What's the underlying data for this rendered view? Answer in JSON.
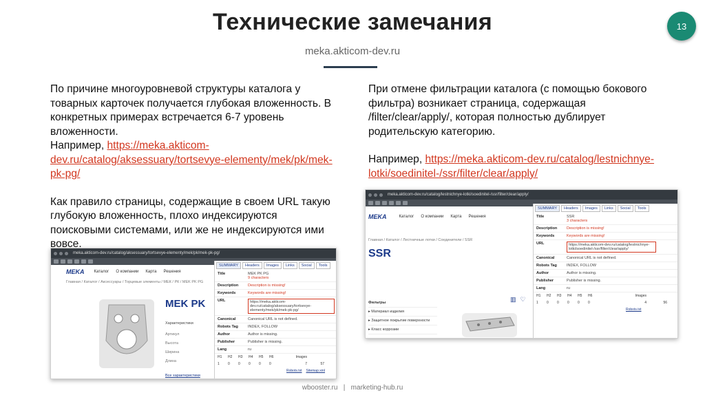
{
  "slide": {
    "title": "Технические замечания",
    "page_number": "13",
    "subtitle": "meka.akticom-dev.ru",
    "footer": "wbooster.ru   |   marketing-hub.ru"
  },
  "left": {
    "para1": "По причине многоуровневой структуры каталога у товарных карточек получается глубокая вложенность. В конкретных примерах встречается 6-7 уровень вложенности.",
    "example_prefix": "Например, ",
    "example_link": "https://meka.akticom-dev.ru/catalog/aksessuary/tortsevye-elementy/mek/pk/mek-pk-pg/",
    "para2": "Как правило страницы, содержащие в своем URL такую глубокую вложенность, плохо индексируются поисковыми системами, или же не индексируются ими вовсе."
  },
  "right": {
    "para1": "При отмене фильтрации каталога (с помощью бокового фильтра) возникает страница, содержащая /filter/clear/apply/, которая полностью дублирует родительскую категорию.",
    "example_prefix": "Например, ",
    "example_link": "https://meka.akticom-dev.ru/catalog/lestnichnye-lotki/soedinitel-/ssr/filter/clear/apply/"
  },
  "shot_left": {
    "browser_url": "meka.akticom-dev.ru/catalog/aksessuary/tortsevye-elementy/mek/pk/mek-pk-pg/",
    "logo": "MEKA",
    "nav": [
      "Каталог",
      "О компании",
      "Карта",
      "Решения"
    ],
    "breadcrumb": "Главная / Каталог / Аксессуары / Торцевые элементы / МЕК / РК / MEK PK PG",
    "product_title": "MEK PK",
    "characteristics": "Характеристики",
    "char_rows": [
      "Артикул",
      "Высота",
      "Ширина",
      "Длина"
    ],
    "all_chars_link": "Все характеристики",
    "tabs": [
      "SUMMARY",
      "Headers",
      "Images",
      "Links",
      "Social",
      "Tools"
    ],
    "rows": [
      {
        "k": "Title",
        "v": "MEK PK PG",
        "red": false
      },
      {
        "k": "Description",
        "v": "Description is missing!",
        "red": true
      },
      {
        "k": "Keywords",
        "v": "Keywords are missing!",
        "red": true
      },
      {
        "k": "URL",
        "v": "https://meka.akticom-dev.ru/catalog/aksessuary/tortsevye-elementy/mek/pk/mek-pk-pg/",
        "red": false
      },
      {
        "k": "Canonical",
        "v": "Canonical URL is not defined.",
        "red": false
      },
      {
        "k": "Robots Tag",
        "v": "INDEX, FOLLOW",
        "red": false
      },
      {
        "k": "Author",
        "v": "Author is missing.",
        "red": false
      },
      {
        "k": "Publisher",
        "v": "Publisher is missing.",
        "red": false
      },
      {
        "k": "Lang",
        "v": "ru",
        "red": false
      }
    ],
    "title_count": "9 characters",
    "heading_labels": [
      "H1",
      "H2",
      "H3",
      "H4",
      "H5",
      "H6",
      "Images"
    ],
    "heading_values": [
      "1",
      "0",
      "0",
      "0",
      "0",
      "0",
      "7",
      "57"
    ],
    "footer_links": [
      "Robots.txt",
      "Sitemap.xml"
    ]
  },
  "shot_right": {
    "browser_url": "meka.akticom-dev.ru/catalog/lestnichnye-lotki/soedinitel-/ssr/filter/clear/apply/",
    "logo": "MEKA",
    "nav": [
      "Каталог",
      "О компании",
      "Карта",
      "Решения"
    ],
    "breadcrumb": "Главная / Каталог / Лестничные лотки / Соединители / SSR",
    "product_title": "SSR",
    "filters_title": "Фильтры",
    "filters": [
      "Материал изделия",
      "Защитное покрытие поверхности",
      "Класс коррозии"
    ],
    "tabs": [
      "SUMMARY",
      "Headers",
      "Images",
      "Links",
      "Social",
      "Tools"
    ],
    "title_count": "3 characters",
    "rows": [
      {
        "k": "Title",
        "v": "SSR",
        "red": false
      },
      {
        "k": "Description",
        "v": "Description is missing!",
        "red": true
      },
      {
        "k": "Keywords",
        "v": "Keywords are missing!",
        "red": true
      },
      {
        "k": "URL",
        "v": "https://meka.akticom-dev.ru/catalog/lestnichnye-lotki/soedinitel-/ssr/filter/clear/apply/",
        "red": false
      },
      {
        "k": "Canonical",
        "v": "Canonical URL is not defined.",
        "red": false
      },
      {
        "k": "Robots Tag",
        "v": "INDEX, FOLLOW",
        "red": false
      },
      {
        "k": "Author",
        "v": "Author is missing.",
        "red": false
      },
      {
        "k": "Publisher",
        "v": "Publisher is missing.",
        "red": false
      },
      {
        "k": "Lang",
        "v": "ru",
        "red": false
      }
    ],
    "heading_labels": [
      "H1",
      "H2",
      "H3",
      "H4",
      "H5",
      "H6",
      "Images"
    ],
    "heading_values": [
      "1",
      "0",
      "0",
      "0",
      "0",
      "0",
      "4",
      "56"
    ],
    "footer_links": [
      "Robots.txt"
    ]
  }
}
